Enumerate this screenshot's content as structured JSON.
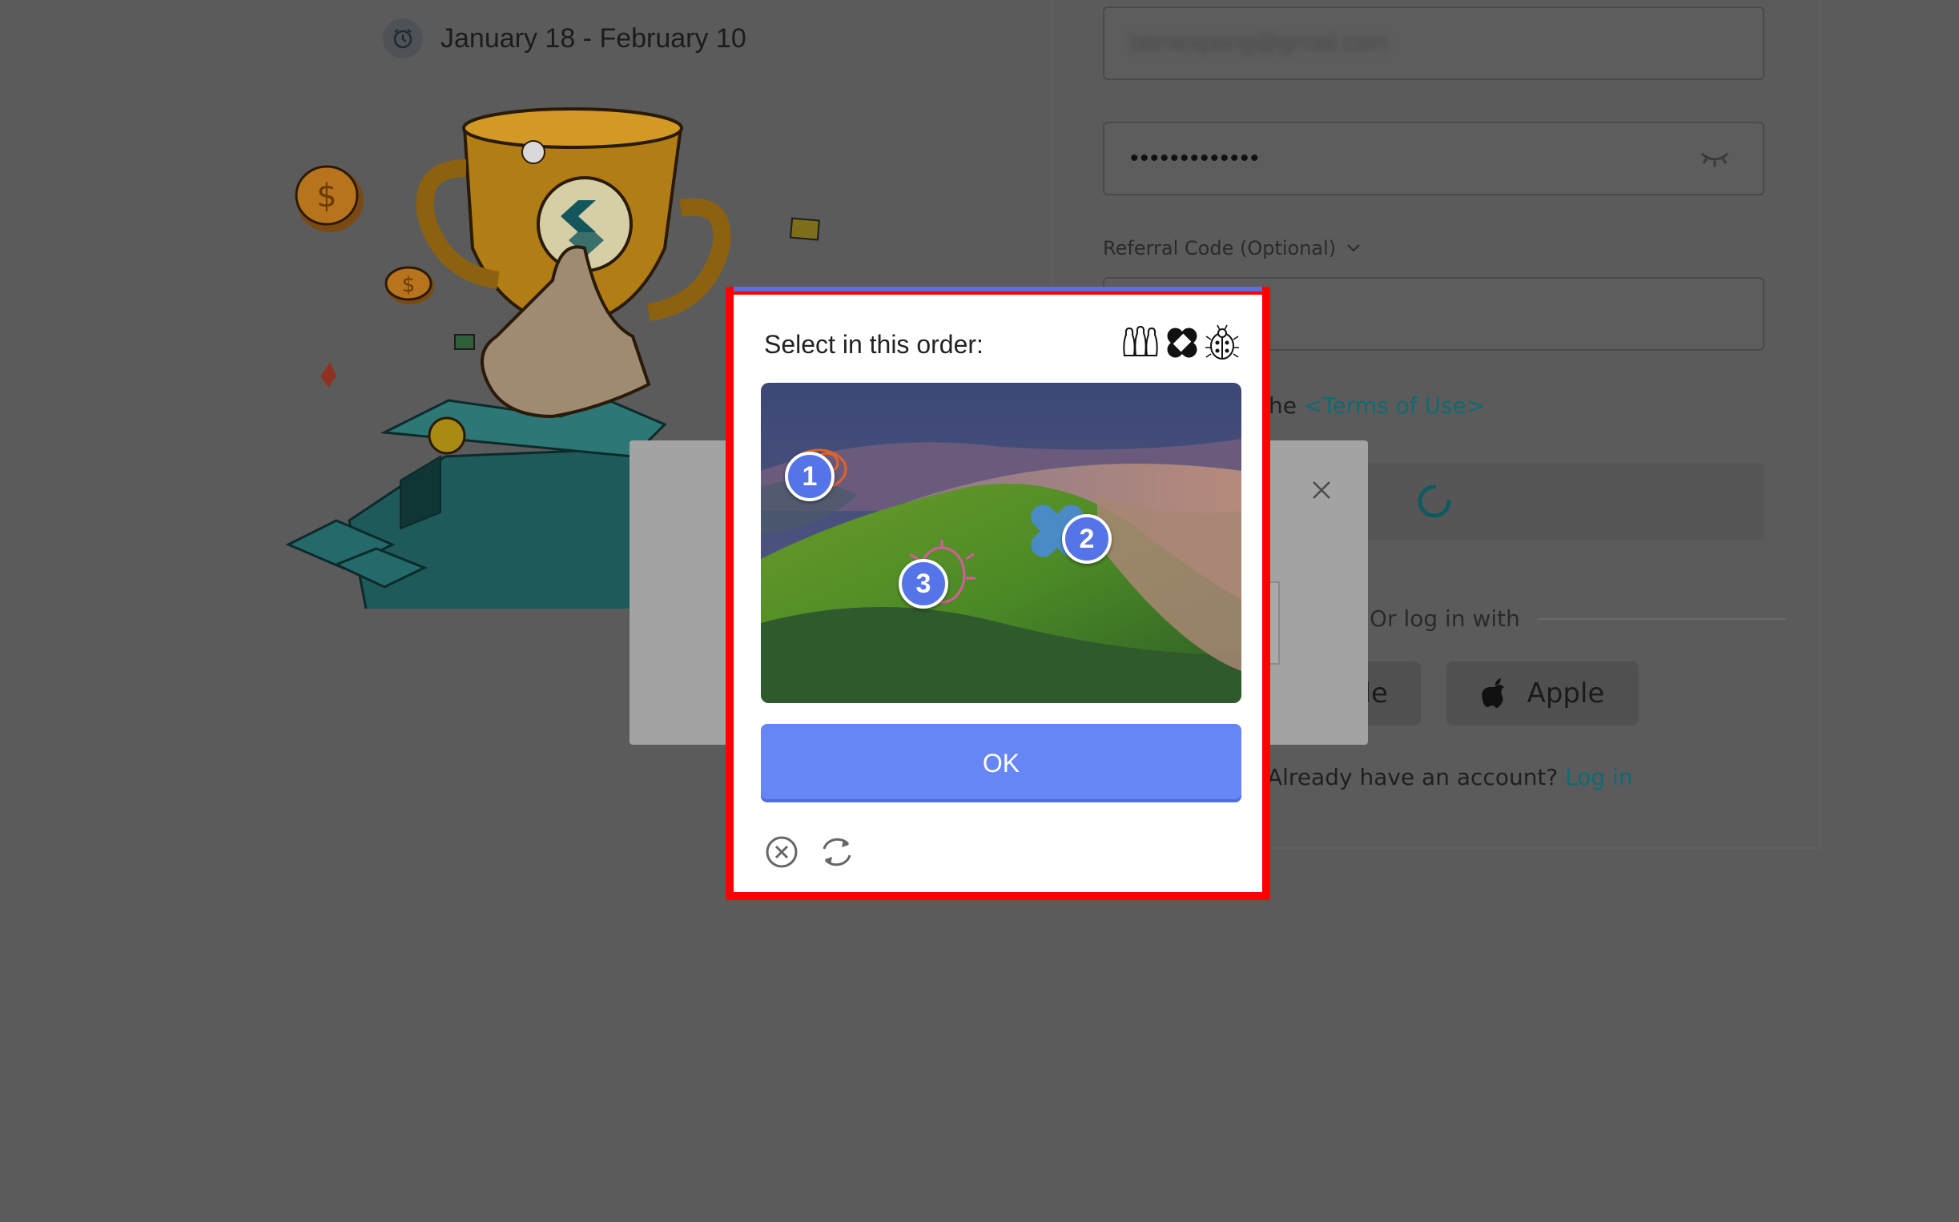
{
  "promo": {
    "date_range": "January 18 - February 10"
  },
  "form": {
    "email_value": "bitmexpong@gmail.com",
    "password_value": "•••••••••••••",
    "referral_label": "Referral Code (Optional)",
    "terms_prefix": "he ",
    "terms_link": "<Terms of Use>",
    "divider_text": "Or log in with",
    "google_label": "gle",
    "apple_label": "Apple",
    "login_prompt": "Already have an account? ",
    "login_link": "Log in"
  },
  "captcha": {
    "title": "Select in this order:",
    "icons": [
      "bowling-pins-icon",
      "bandage-icon",
      "ladybug-icon"
    ],
    "ok_label": "OK",
    "markers": [
      "1",
      "2",
      "3"
    ],
    "accent_color": "#6686f6",
    "frame_color": "#ff0000"
  }
}
